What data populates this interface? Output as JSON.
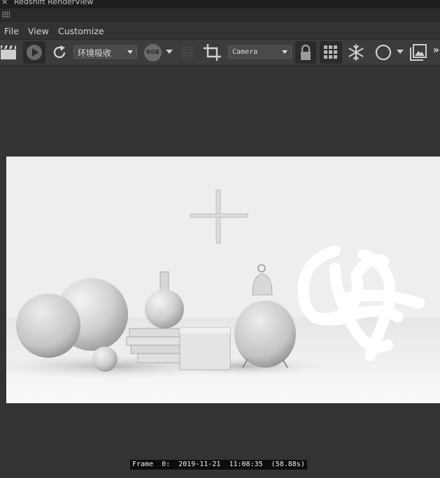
{
  "window": {
    "title": "Redshift RenderView",
    "close_glyph": "×"
  },
  "menu": {
    "items": [
      "File",
      "View",
      "Customize"
    ]
  },
  "toolbar": {
    "aov_select": "环境吸收",
    "rgb_label": "RGB",
    "camera_select": "Camera",
    "overflow_glyph": "»",
    "icons": [
      "clapper-icon",
      "play-icon",
      "refresh-icon",
      "rgb-icon",
      "dot-grid-icon",
      "crop-icon",
      "lock-icon",
      "grid-icon",
      "snowflake-icon",
      "circle-icon",
      "image-icon"
    ]
  },
  "status": {
    "frame_info": "Frame  0:  2019-11-21  11:08:35  (58.88s)"
  },
  "colors": {
    "background": "#333333",
    "toolbar": "#3c3c3c",
    "render_bg": "#f1f1f1"
  }
}
